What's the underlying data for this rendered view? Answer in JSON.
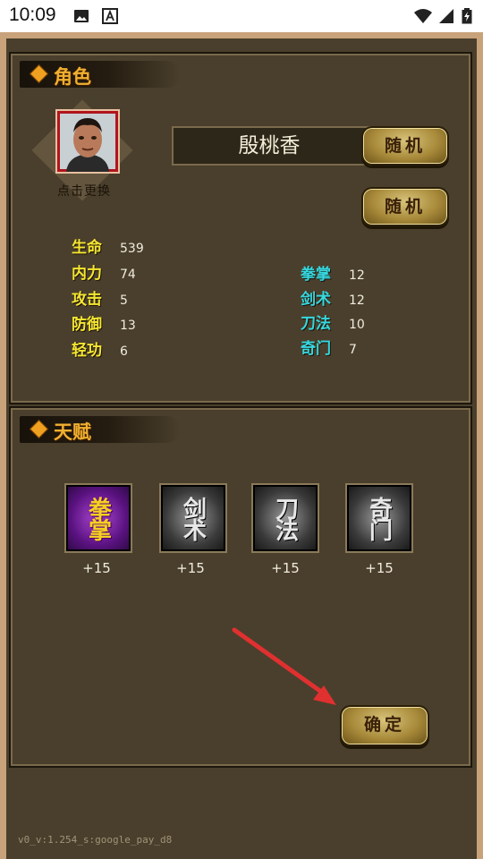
{
  "status_bar": {
    "time": "10:09"
  },
  "role_section": {
    "title": "角色",
    "avatar_caption": "点击更换",
    "name": "殷桃香",
    "random_name_label": "随机",
    "random_stats_label": "随机",
    "stats_left": [
      {
        "label": "生命",
        "value": "539"
      },
      {
        "label": "内力",
        "value": "74"
      },
      {
        "label": "攻击",
        "value": "5"
      },
      {
        "label": "防御",
        "value": "13"
      },
      {
        "label": "轻功",
        "value": "6"
      }
    ],
    "stats_right": [
      {
        "label": "拳掌",
        "value": "12"
      },
      {
        "label": "剑术",
        "value": "12"
      },
      {
        "label": "刀法",
        "value": "10"
      },
      {
        "label": "奇门",
        "value": "7"
      }
    ]
  },
  "talent_section": {
    "title": "天赋",
    "talents": [
      {
        "glyph": "拳掌",
        "bonus": "+15",
        "state": "selected"
      },
      {
        "glyph": "剑术",
        "bonus": "+15",
        "state": "unselected"
      },
      {
        "glyph": "刀法",
        "bonus": "+15",
        "state": "unselected"
      },
      {
        "glyph": "奇门",
        "bonus": "+15",
        "state": "unselected"
      }
    ]
  },
  "confirm_label": "确定",
  "version_text": "v0_v:1.254_s:google_pay_d8",
  "colors": {
    "background": "#4a3f2c",
    "frame": "#c8a27a",
    "stat_left_color": "#f5e630",
    "stat_right_color": "#35d8e0",
    "annotation_arrow": "#e03030"
  },
  "icons": [
    "gallery-icon",
    "font-icon",
    "wifi-icon",
    "signal-icon",
    "battery-charging-icon",
    "annotation-arrow-icon"
  ]
}
